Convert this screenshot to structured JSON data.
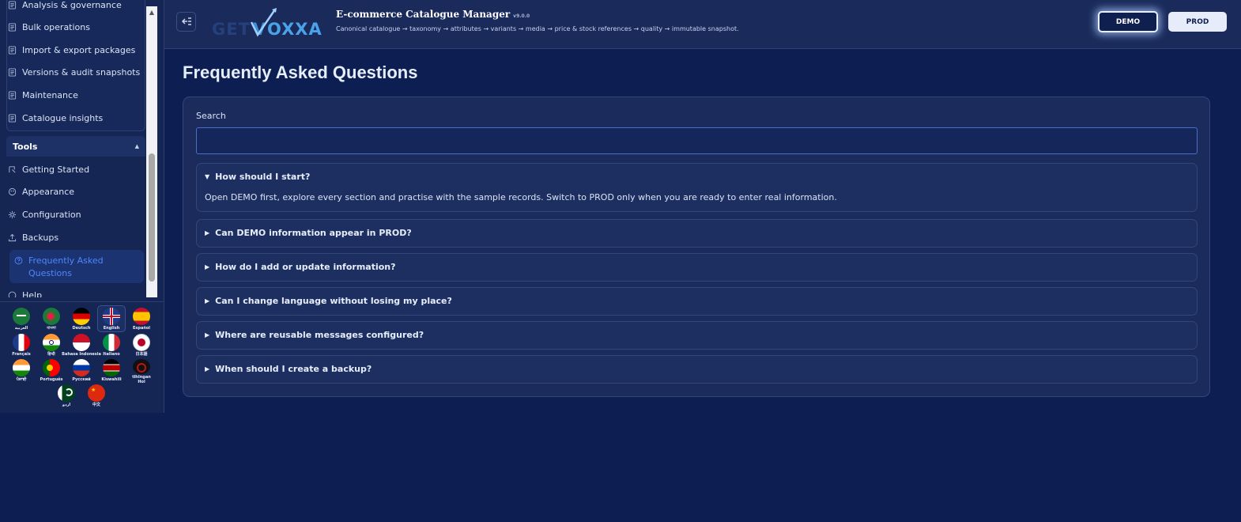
{
  "header": {
    "app_title": "E-commerce Catalogue Manager",
    "version": "v9.0.0",
    "subtitle": "Canonical catalogue → taxonomy → attributes → variants → media → price & stock references → quality → immutable snapshot.",
    "logo_text": "GETVOXXA",
    "demo_label": "DEMO",
    "prod_label": "PROD"
  },
  "sidebar": {
    "top_items": [
      {
        "label": "Analysis & governance",
        "icon": "document-icon"
      },
      {
        "label": "Bulk operations",
        "icon": "document-icon"
      },
      {
        "label": "Import & export packages",
        "icon": "document-icon"
      },
      {
        "label": "Versions & audit snapshots",
        "icon": "document-icon"
      },
      {
        "label": "Maintenance",
        "icon": "document-icon"
      },
      {
        "label": "Catalogue insights",
        "icon": "document-icon"
      }
    ],
    "tools_title": "Tools",
    "tools_items": [
      {
        "label": "Getting Started",
        "icon": "start-icon"
      },
      {
        "label": "Appearance",
        "icon": "palette-icon"
      },
      {
        "label": "Configuration",
        "icon": "gear-icon"
      },
      {
        "label": "Backups",
        "icon": "upload-icon"
      },
      {
        "label": "Frequently Asked Questions",
        "icon": "help-icon"
      },
      {
        "label": "Help",
        "icon": "help-icon"
      }
    ],
    "languages": [
      {
        "label": "العربية",
        "colors": "#1b7a3a"
      },
      {
        "label": "বাংলা",
        "colors": "#1b7a3a"
      },
      {
        "label": "Deutsch",
        "colors": "#000000"
      },
      {
        "label": "English",
        "colors": "#1f3a8a"
      },
      {
        "label": "Español",
        "colors": "#c8102e"
      },
      {
        "label": "Français",
        "colors": "#1f3a8a"
      },
      {
        "label": "हिन्दी",
        "colors": "#ff9933"
      },
      {
        "label": "Bahasa Indonesia",
        "colors": "#ce1126"
      },
      {
        "label": "Italiano",
        "colors": "#009246"
      },
      {
        "label": "日本語",
        "colors": "#ffffff"
      },
      {
        "label": "ਪੰਜਾਬੀ",
        "colors": "#ff9933"
      },
      {
        "label": "Português",
        "colors": "#006600"
      },
      {
        "label": "Русский",
        "colors": "#0039a6"
      },
      {
        "label": "Kiswahili",
        "colors": "#000000"
      },
      {
        "label": "tlhIngan Hol",
        "colors": "#000000"
      },
      {
        "label": "اردو",
        "colors": "#01411c"
      },
      {
        "label": "中文",
        "colors": "#de2910"
      }
    ]
  },
  "main": {
    "title": "Frequently Asked Questions",
    "search_label": "Search",
    "search_value": "",
    "faqs": [
      {
        "question": "How should I start?",
        "answer": "Open DEMO first, explore every section and practise with the sample records. Switch to PROD only when you are ready to enter real information.",
        "expanded": true
      },
      {
        "question": "Can DEMO information appear in PROD?",
        "expanded": false
      },
      {
        "question": "How do I add or update information?",
        "expanded": false
      },
      {
        "question": "Can I change language without losing my place?",
        "expanded": false
      },
      {
        "question": "Where are reusable messages configured?",
        "expanded": false
      },
      {
        "question": "When should I create a backup?",
        "expanded": false
      }
    ]
  }
}
